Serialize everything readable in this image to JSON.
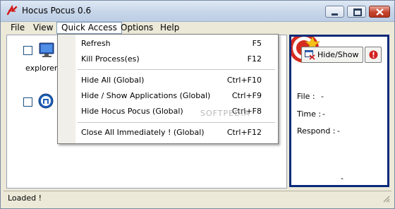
{
  "window": {
    "title": "Hocus Pocus 0.6"
  },
  "menubar": {
    "items": [
      "File",
      "View",
      "Quick Access",
      "Options",
      "Help"
    ]
  },
  "apps": [
    {
      "label": "explorer",
      "checked": false
    },
    {
      "label": "",
      "checked": false
    }
  ],
  "quick_access": {
    "items": [
      {
        "label": "Refresh",
        "shortcut": "F5"
      },
      {
        "label": "Kill Process(es)",
        "shortcut": "F12"
      },
      {
        "label": "Hide All (Global)",
        "shortcut": "Ctrl+F10"
      },
      {
        "label": "Hide / Show Applications (Global)",
        "shortcut": "Ctrl+F9"
      },
      {
        "label": "Hide Hocus Pocus (Global)",
        "shortcut": "Ctrl+F8"
      },
      {
        "label": "Close All Immediately ! (Global)",
        "shortcut": "Ctrl+F12"
      }
    ]
  },
  "panel": {
    "hide_show_label": "Hide/Show",
    "file_label": "File :",
    "file_value": "-",
    "time_label": "Time :",
    "time_value": "-",
    "respond_label": "Respond :",
    "respond_value": "-",
    "bottom_value": "-"
  },
  "status": {
    "text": "Loaded !"
  },
  "watermark": "SOFTPEDIA",
  "colors": {
    "panel_border": "#0a2a7a",
    "close_button": "#c7432d",
    "warn_icon": "#d32020"
  }
}
